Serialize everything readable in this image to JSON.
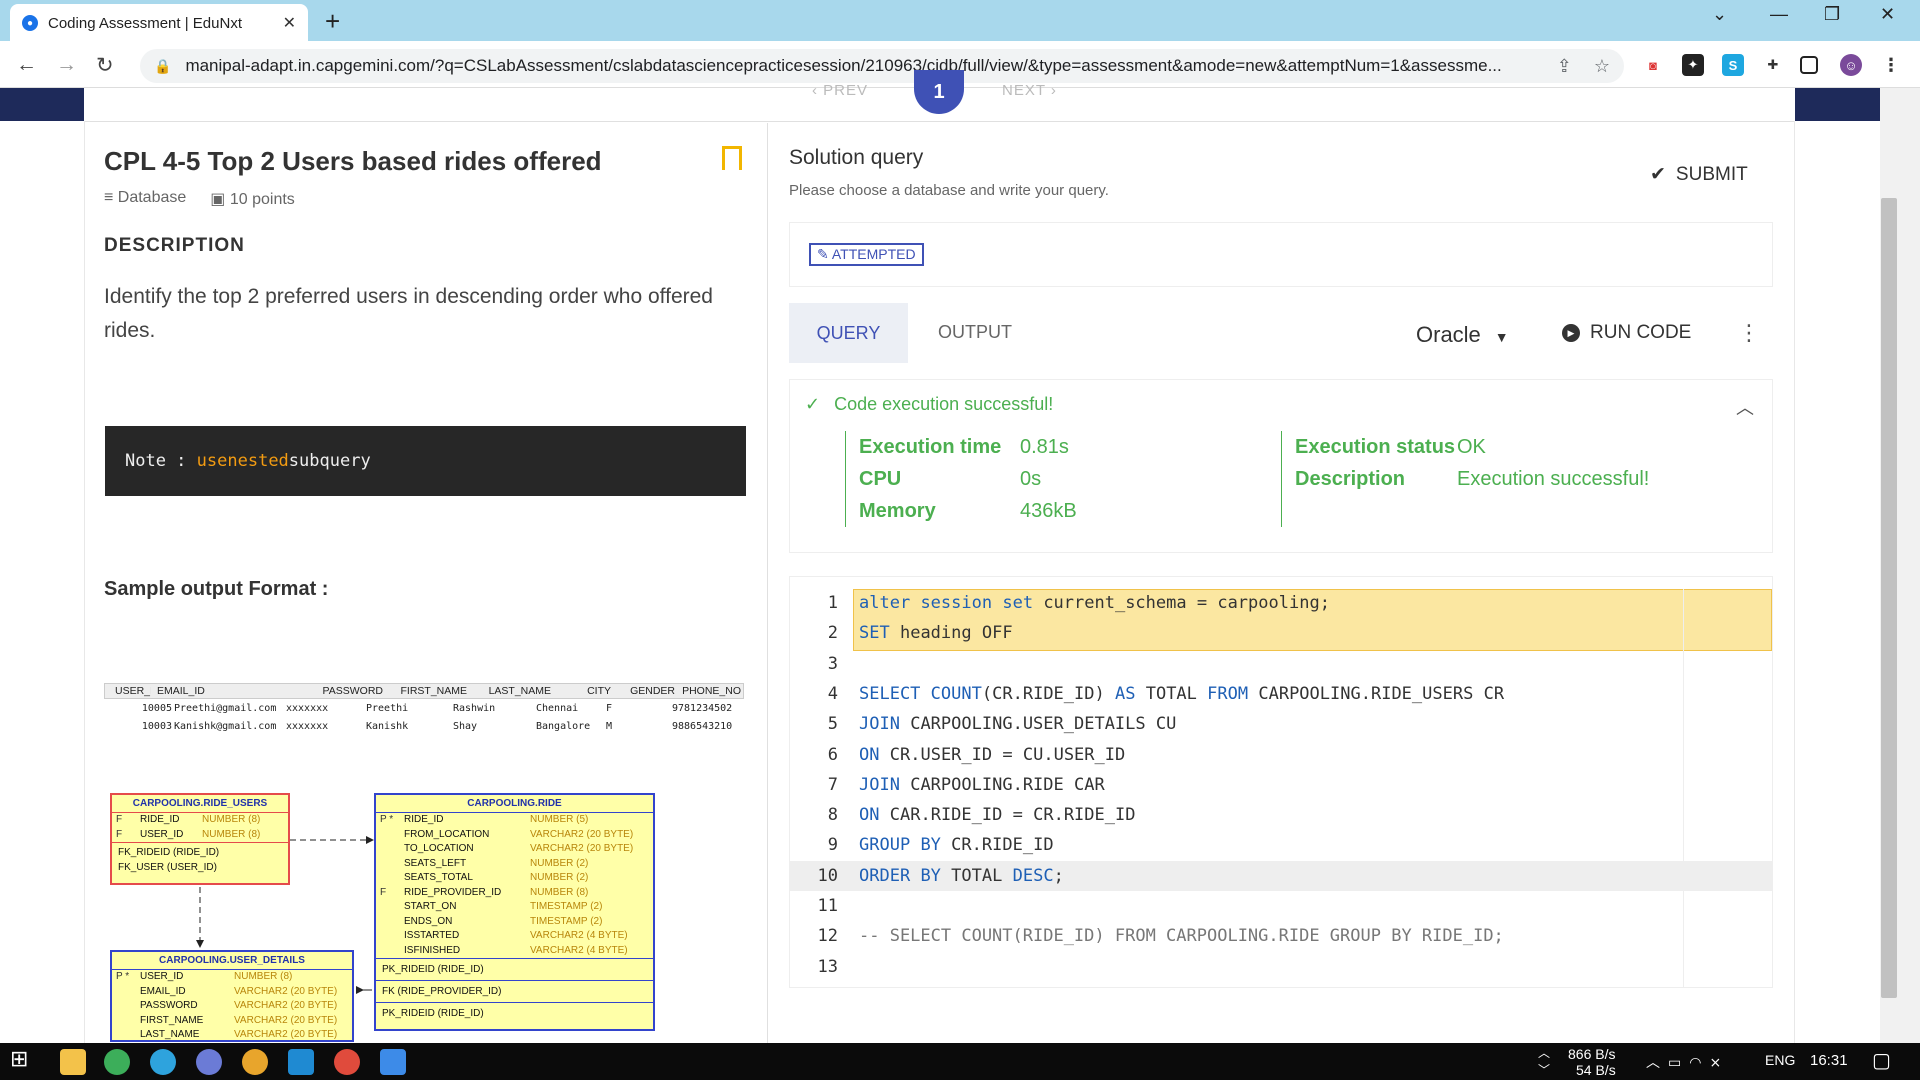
{
  "browser": {
    "tab_title": "Coding Assessment | EduNxt",
    "url": "manipal-adapt.in.capgemini.com/?q=CSLabAssessment/cslabdatasciencepracticesession/210963/cidb/full/view/&type=assessment&amode=new&attemptNum=1&assessme..."
  },
  "nav": {
    "prev": "‹ PREV",
    "next": "NEXT ›",
    "question_number": "1"
  },
  "question": {
    "title": "CPL 4-5 Top 2 Users based rides offered",
    "category": "Database",
    "points": "10 points",
    "description_heading": "DESCRIPTION",
    "description": "Identify the top 2 preferred users in descending order who offered rides.",
    "note_prefix": "Note : ",
    "note_kw1": "use",
    "note_kw2": "nested",
    "note_suffix": "subquery",
    "sample_heading": "Sample output Format :"
  },
  "sample_table": {
    "headers": [
      "USER_ID",
      "EMAIL_ID",
      "PASSWORD",
      "FIRST_NAME",
      "LAST_NAME",
      "CITY",
      "GENDER",
      "PHONE_NO"
    ],
    "rows": [
      [
        "10005",
        "Preethi@gmail.com",
        "xxxxxxx",
        "Preethi",
        "Rashwin",
        "Chennai",
        "F",
        "9781234502"
      ],
      [
        "10003",
        "Kanishk@gmail.com",
        "xxxxxxx",
        "Kanishk",
        "Shay",
        "Bangalore",
        "M",
        "9886543210"
      ]
    ]
  },
  "er": {
    "ride_users": {
      "title": "CARPOOLING.RIDE_USERS",
      "cols": [
        [
          "F",
          "RIDE_ID",
          "NUMBER (8)"
        ],
        [
          "F",
          "USER_ID",
          "NUMBER (8)"
        ]
      ],
      "fks": [
        "FK_RIDEID (RIDE_ID)",
        "FK_USER (USER_ID)"
      ]
    },
    "ride": {
      "title": "CARPOOLING.RIDE",
      "cols": [
        [
          "P *",
          "RIDE_ID",
          "NUMBER (5)"
        ],
        [
          "",
          "FROM_LOCATION",
          "VARCHAR2 (20 BYTE)"
        ],
        [
          "",
          "TO_LOCATION",
          "VARCHAR2 (20 BYTE)"
        ],
        [
          "",
          "SEATS_LEFT",
          "NUMBER (2)"
        ],
        [
          "",
          "SEATS_TOTAL",
          "NUMBER (2)"
        ],
        [
          "F",
          "RIDE_PROVIDER_ID",
          "NUMBER (8)"
        ],
        [
          "",
          "START_ON",
          "TIMESTAMP (2)"
        ],
        [
          "",
          "ENDS_ON",
          "TIMESTAMP (2)"
        ],
        [
          "",
          "ISSTARTED",
          "VARCHAR2 (4 BYTE)"
        ],
        [
          "",
          "ISFINISHED",
          "VARCHAR2 (4 BYTE)"
        ]
      ],
      "keys": [
        "PK_RIDEID (RIDE_ID)",
        "FK (RIDE_PROVIDER_ID)",
        "PK_RIDEID (RIDE_ID)"
      ]
    },
    "user_details": {
      "title": "CARPOOLING.USER_DETAILS",
      "cols": [
        [
          "P *",
          "USER_ID",
          "NUMBER (8)"
        ],
        [
          "",
          "EMAIL_ID",
          "VARCHAR2 (20 BYTE)"
        ],
        [
          "",
          "PASSWORD",
          "VARCHAR2 (20 BYTE)"
        ],
        [
          "",
          "FIRST_NAME",
          "VARCHAR2 (20 BYTE)"
        ],
        [
          "",
          "LAST_NAME",
          "VARCHAR2 (20 BYTE)"
        ]
      ]
    }
  },
  "solution": {
    "heading": "Solution query",
    "subheading": "Please choose a database and write your query.",
    "submit": "SUBMIT",
    "status_badge": "ATTEMPTED",
    "tab_query": "QUERY",
    "tab_output": "OUTPUT",
    "database": "Oracle",
    "run": "RUN CODE"
  },
  "result": {
    "message": "Code execution successful!",
    "exec_time_label": "Execution time",
    "exec_time": "0.81s",
    "cpu_label": "CPU",
    "cpu": "0s",
    "memory_label": "Memory",
    "memory": "436kB",
    "status_label": "Execution status",
    "status": "OK",
    "desc_label": "Description",
    "desc": "Execution successful!"
  },
  "code_lines": [
    "alter session set current_schema = carpooling;",
    "SET heading OFF",
    "",
    "SELECT COUNT(CR.RIDE_ID) AS TOTAL FROM CARPOOLING.RIDE_USERS CR",
    "JOIN CARPOOLING.USER_DETAILS CU",
    "ON CR.USER_ID = CU.USER_ID",
    "JOIN CARPOOLING.RIDE CAR",
    "ON CAR.RIDE_ID = CR.RIDE_ID",
    "GROUP BY CR.RIDE_ID",
    "ORDER BY TOTAL DESC;",
    "",
    "-- SELECT COUNT(RIDE_ID) FROM CARPOOLING.RIDE GROUP BY RIDE_ID;",
    ""
  ],
  "taskbar": {
    "net_up": "866 B/s",
    "net_down": "54 B/s",
    "lang": "ENG",
    "time": "16:31"
  },
  "colors": {
    "accent": "#3f51b5",
    "success": "#4caf50",
    "highlight": "#fbe7a1"
  }
}
